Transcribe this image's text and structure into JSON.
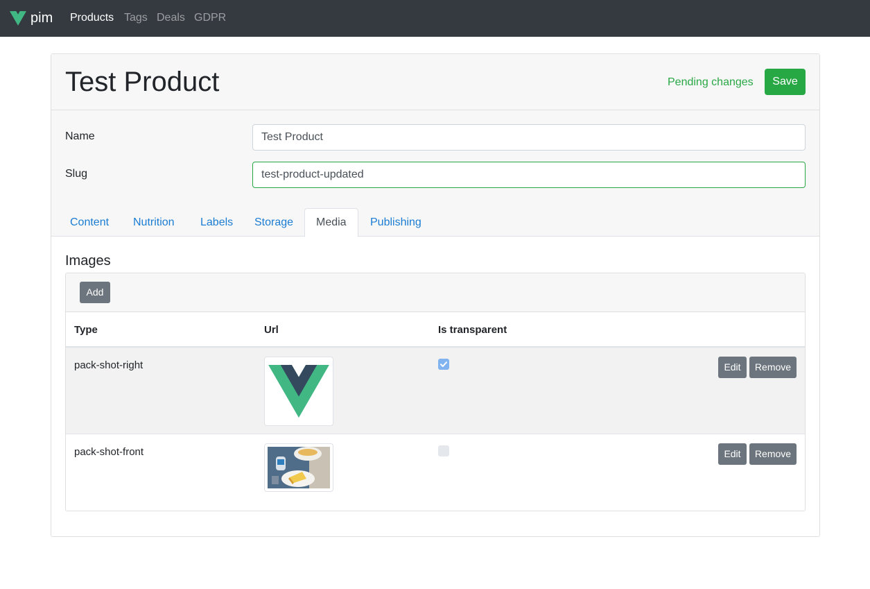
{
  "navbar": {
    "brand": "pim",
    "links": [
      {
        "label": "Products",
        "active": true
      },
      {
        "label": "Tags",
        "active": false
      },
      {
        "label": "Deals",
        "active": false
      },
      {
        "label": "GDPR",
        "active": false
      }
    ]
  },
  "header": {
    "title": "Test Product",
    "status": "Pending changes",
    "save_label": "Save"
  },
  "form": {
    "name": {
      "label": "Name",
      "value": "Test Product"
    },
    "slug": {
      "label": "Slug",
      "value": "test-product-updated"
    }
  },
  "tabs": [
    {
      "label": "Content",
      "active": false
    },
    {
      "label": "Nutrition",
      "active": false
    },
    {
      "label": "Labels",
      "active": false
    },
    {
      "label": "Storage",
      "active": false
    },
    {
      "label": "Media",
      "active": true
    },
    {
      "label": "Publishing",
      "active": false
    }
  ],
  "images": {
    "title": "Images",
    "add_label": "Add",
    "columns": [
      "Type",
      "Url",
      "Is transparent"
    ],
    "rows": [
      {
        "type": "pack-shot-right",
        "thumbnail": "vue-logo",
        "is_transparent": true,
        "edit_label": "Edit",
        "remove_label": "Remove"
      },
      {
        "type": "pack-shot-front",
        "thumbnail": "product-photo",
        "is_transparent": false,
        "edit_label": "Edit",
        "remove_label": "Remove"
      }
    ]
  },
  "colors": {
    "navbar": "#343a40",
    "success": "#28a745",
    "link": "#1a7cd2",
    "secondary": "#6c757d",
    "vue_green": "#41b883",
    "vue_dark": "#34495e"
  }
}
